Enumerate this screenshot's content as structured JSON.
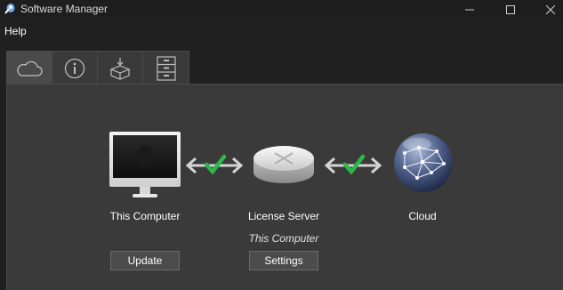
{
  "window": {
    "title": "Software Manager",
    "controls": [
      "minimize-icon",
      "maximize-icon",
      "close-icon"
    ]
  },
  "menu": {
    "help": "Help"
  },
  "tabs": [
    {
      "icon": "cloud-icon",
      "selected": true
    },
    {
      "icon": "info-icon",
      "selected": false
    },
    {
      "icon": "install-box-icon",
      "selected": false
    },
    {
      "icon": "file-cabinet-icon",
      "selected": false
    }
  ],
  "nodes": {
    "computer": {
      "label": "This Computer",
      "icon": "imac-icon"
    },
    "server": {
      "label": "License Server",
      "sublabel": "This Computer",
      "icon": "router-icon"
    },
    "cloud": {
      "label": "Cloud",
      "icon": "network-globe-icon"
    }
  },
  "links": [
    {
      "from": "computer",
      "to": "server",
      "status": "connected"
    },
    {
      "from": "server",
      "to": "cloud",
      "status": "connected"
    }
  ],
  "buttons": {
    "update": "Update",
    "settings": "Settings"
  },
  "colors": {
    "background": "#202020",
    "panel": "#3a3a3a",
    "check": "#2db84a"
  }
}
